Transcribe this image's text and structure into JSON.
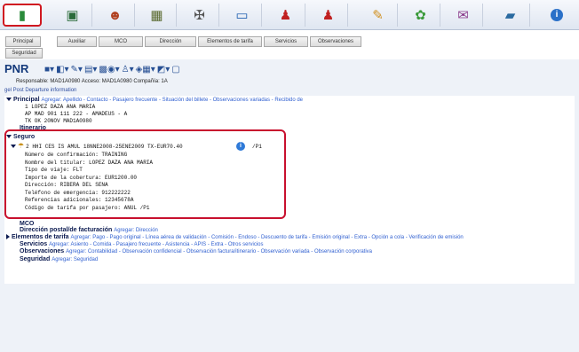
{
  "toolbar": {
    "icons": [
      "book-icon",
      "monitor-icon",
      "person-icon",
      "box-icon",
      "car-icon",
      "bus-icon",
      "agent-icon",
      "agent2-icon",
      "ticket-icon",
      "tools-icon",
      "doc-icon",
      "help-icon"
    ]
  },
  "tabs_row1": [
    "Principal",
    "Auxiliar",
    "MCO",
    "Dirección",
    "Elementos de tarifa",
    "Servicios",
    "Observaciones"
  ],
  "tabs_row2": [
    "Seguridad"
  ],
  "pnr": {
    "title": "PNR",
    "responsable_line": "Responsable: MAD1A0980     Acceso: MAD1A0980     Compañía: 1A",
    "gel_link": "gel Post Departure information"
  },
  "principal": {
    "label": "Principal",
    "links": "Agregar: Apellido - Contacto - Pasajero frecuente - Situación del billete - Observaciones variadas - Recibido de",
    "lines": [
      "1 LOPEZ DAZA ANA MARIA",
      "AP MAD 901 111 222 - AMADEUS - A",
      "TK OK 20NOV MAD1A0980"
    ]
  },
  "itinerario": {
    "label": "Itinerario"
  },
  "seguro": {
    "label": "Seguro",
    "segment": "2  HHI CES IS AMUL 18NNE2008-25ENE2009 TX-EUR70.40",
    "segment_suffix": "/P1",
    "details": [
      "Número de confirmación: TRAINING",
      "Nombre del titular: LOPEZ DAZA ANA MARIA",
      "Tipo de viaje: FLT",
      "Importe de la cobertura: EUR1200.00",
      "Dirección: RIBERA DEL SENA",
      "Teléfono de emergencia: 912222222",
      "Referencias adicionales: 12345678A",
      "Código de tarifa por pasajero: ANUL  /P1"
    ]
  },
  "sections": [
    {
      "label": "MCO",
      "links": ""
    },
    {
      "label": "Dirección postal/de facturación",
      "links": "Agregar: Dirección"
    },
    {
      "label": "Elementos de tarifa",
      "links": "Agregar: Pago - Pago original - Línea aérea de validación - Comisión - Endoso - Descuento de tarifa - Emisión original - Extra - Opción a cola - Verificación de emisión"
    },
    {
      "label": "Servicios",
      "links": "Agregar: Asiento - Comida - Pasajero frecuente - Asistencia - APIS - Extra - Otros servicios"
    },
    {
      "label": "Observaciones",
      "links": "Agregar: Contabilidad - Observación confidencial - Observación factura/itinerario - Observación variada - Observación corporativa"
    },
    {
      "label": "Seguridad",
      "links": "Agregar: Seguridad"
    }
  ]
}
